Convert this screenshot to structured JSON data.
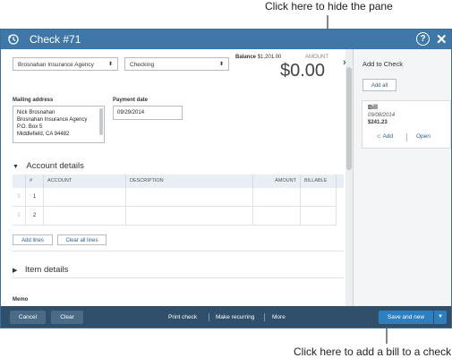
{
  "callouts": {
    "top": "Click here to hide the pane",
    "bottom": "Click here to add a bill to a check"
  },
  "titlebar": {
    "title": "Check #71",
    "help_icon": "?",
    "close_icon": "✕"
  },
  "form": {
    "payee": "Brosnahan Insurance Agency",
    "account": "Checking",
    "balance_label": "Balance",
    "balance_value": "$1,201.00",
    "amount_label": "AMOUNT",
    "amount_value": "$0.00",
    "mailing_label": "Mailing address",
    "mailing_lines": [
      "Nick Brosnahan",
      "Brosnahan Insurance Agency",
      "P.O. Box 5",
      "Middlefield, CA  94482"
    ],
    "payment_date_label": "Payment date",
    "payment_date_value": "09/29/2014"
  },
  "account_details": {
    "heading": "Account details",
    "columns": [
      "#",
      "ACCOUNT",
      "DESCRIPTION",
      "AMOUNT",
      "BILLABLE"
    ],
    "rows": [
      {
        "num": "1"
      },
      {
        "num": "2"
      }
    ],
    "add_lines": "Add lines",
    "clear_lines": "Clear all lines"
  },
  "item_details": {
    "heading": "Item details"
  },
  "memo": {
    "label": "Memo"
  },
  "pane": {
    "title": "Add to Check",
    "add_all": "Add all",
    "bill": {
      "title": "Bill",
      "date": "09/08/2014",
      "amount": "$241.23",
      "add": "Add",
      "open": "Open"
    }
  },
  "footer": {
    "cancel": "Cancel",
    "clear": "Clear",
    "print_check": "Print check",
    "make_recurring": "Make recurring",
    "more": "More",
    "save_and_new": "Save and new"
  },
  "colors": {
    "titlebar": "#3f78a8",
    "footer": "#2f4f6b",
    "save_button": "#2d7fbf",
    "link": "#2b5d8a"
  }
}
